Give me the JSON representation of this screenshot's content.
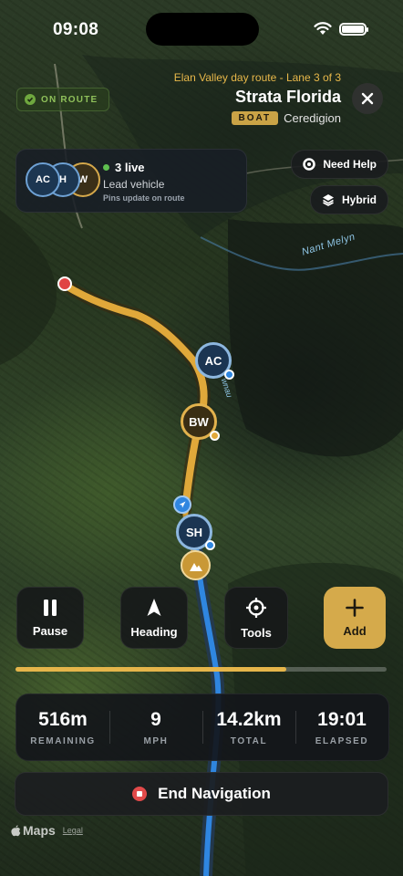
{
  "status_bar": {
    "time": "09:08"
  },
  "route_status": {
    "label": "ON ROUTE"
  },
  "route": {
    "subtitle": "Elan Valley day route - Lane 3 of 3",
    "title": "Strata Florida",
    "badge": "BOAT",
    "region": "Ceredigion"
  },
  "live": {
    "count_label": "3 live",
    "role": "Lead vehicle",
    "note": "Pins update on route",
    "avatars": [
      "AC",
      "H",
      "W"
    ]
  },
  "map_actions": {
    "help_label": "Need Help",
    "layer_label": "Hybrid"
  },
  "map_labels": {
    "river_1": "Nant Melyn",
    "river_2": "wnau"
  },
  "markers": {
    "ac": "AC",
    "bw": "BW",
    "sh": "SH"
  },
  "controls": {
    "pause_label": "Pause",
    "heading_label": "Heading",
    "tools_label": "Tools",
    "add_label": "Add"
  },
  "progress": {
    "fraction": 0.73
  },
  "stats": [
    {
      "value": "516m",
      "label": "REMAINING"
    },
    {
      "value": "9",
      "label": "MPH"
    },
    {
      "value": "14.2km",
      "label": "TOTAL"
    },
    {
      "value": "19:01",
      "label": "ELAPSED"
    }
  ],
  "end_button": {
    "label": "End Navigation"
  },
  "attribution": {
    "maps": "Maps",
    "legal": "Legal"
  },
  "colors": {
    "accent": "#D5AA4B",
    "route": "#E0A83A",
    "water": "#2F86E0",
    "danger": "#E24A4A",
    "live": "#5FBF4F"
  },
  "icons": [
    "wifi-icon",
    "battery-icon",
    "check-icon",
    "close-icon",
    "lifebuoy-icon",
    "layers-icon",
    "pause-icon",
    "heading-arrow-icon",
    "crosshair-icon",
    "plus-icon",
    "stop-icon",
    "apple-icon",
    "mountain-icon"
  ]
}
